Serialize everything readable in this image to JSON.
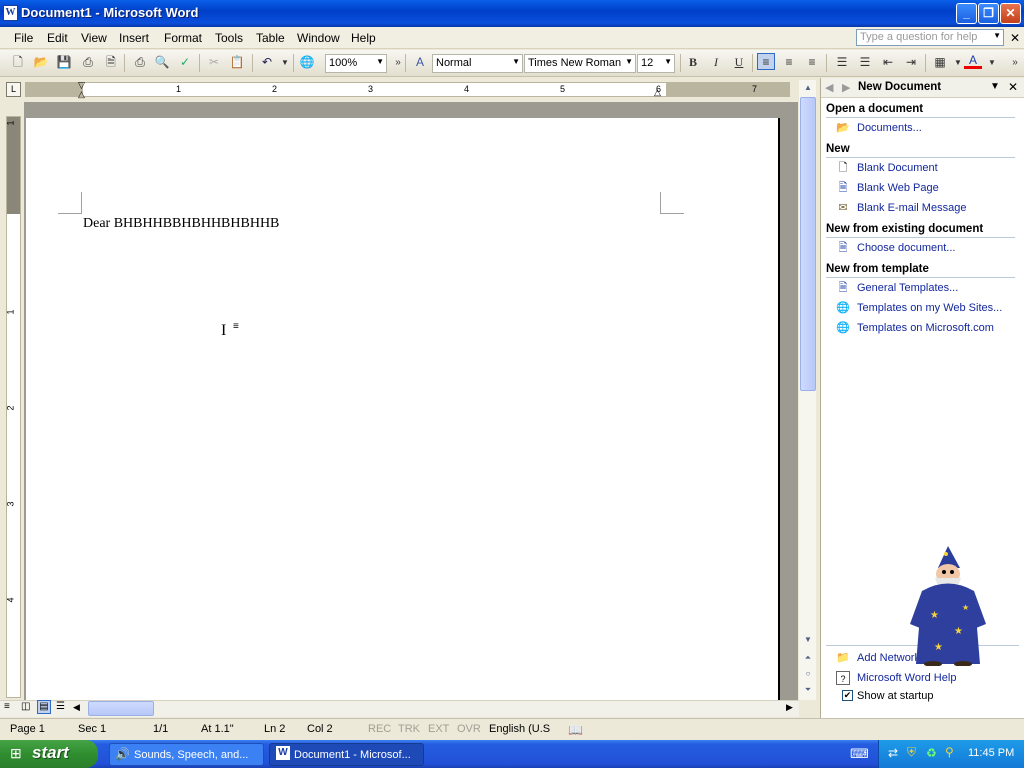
{
  "window": {
    "title": "Document1 - Microsoft Word",
    "word_icon": "W"
  },
  "menu": [
    "File",
    "Edit",
    "View",
    "Insert",
    "Format",
    "Tools",
    "Table",
    "Window",
    "Help"
  ],
  "help_box": {
    "placeholder": "Type a question for help"
  },
  "toolbar": {
    "zoom": "100%",
    "style": "Normal",
    "font": "Times New Roman",
    "size": "12"
  },
  "ruler": {
    "h_numbers": [
      "1",
      "2",
      "3",
      "4",
      "5",
      "6",
      "7"
    ],
    "v_numbers": [
      "1",
      "1",
      "2",
      "3",
      "4"
    ],
    "corner": "L"
  },
  "document": {
    "text": "Dear BHBHHBBHBHHBHBHHB"
  },
  "task_pane": {
    "title": "New Document",
    "sections": [
      {
        "heading": "Open a document",
        "links": [
          "Documents..."
        ]
      },
      {
        "heading": "New",
        "links": [
          "Blank Document",
          "Blank Web Page",
          "Blank E-mail Message"
        ]
      },
      {
        "heading": "New from existing document",
        "links": [
          "Choose document..."
        ]
      },
      {
        "heading": "New from template",
        "links": [
          "General Templates...",
          "Templates on my Web Sites...",
          "Templates on Microsoft.com"
        ]
      }
    ],
    "bottom_links": [
      "Add Network Place...",
      "Microsoft Word Help"
    ],
    "show_at_startup": "Show at startup"
  },
  "status": {
    "page": "Page 1",
    "sec": "Sec 1",
    "pages": "1/1",
    "at": "At 1.1\"",
    "ln": "Ln 2",
    "col": "Col 2",
    "rec": "REC",
    "trk": "TRK",
    "ext": "EXT",
    "ovr": "OVR",
    "lang": "English (U.S"
  },
  "taskbar": {
    "start": "start",
    "items": [
      "Sounds, Speech, and...",
      "Document1 - Microsof..."
    ],
    "clock": "11:45 PM"
  },
  "colors": {
    "title_blue": "#0a4edc",
    "link_blue": "#13279c",
    "taskbar_blue": "#245de0",
    "start_green": "#2f8e2f"
  }
}
